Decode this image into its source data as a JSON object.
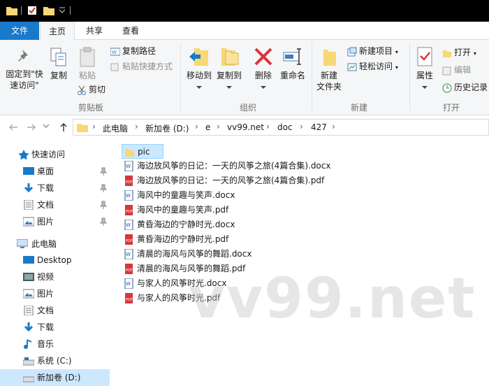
{
  "ribbon_tabs": [
    "文件",
    "主页",
    "共享",
    "查看"
  ],
  "clipboard": {
    "pin_label_1": "固定到\"快",
    "pin_label_2": "速访问\"",
    "copy": "复制",
    "paste": "粘贴",
    "copy_path": "复制路径",
    "paste_shortcut": "粘贴快捷方式",
    "cut": "剪切",
    "group": "剪贴板"
  },
  "organize": {
    "move_to": "移动到",
    "copy_to": "复制到",
    "delete": "删除",
    "rename": "重命名",
    "group": "组织"
  },
  "new": {
    "new_folder_1": "新建",
    "new_folder_2": "文件夹",
    "new_item": "新建项目",
    "easy_access": "轻松访问",
    "group": "新建"
  },
  "open": {
    "properties": "属性",
    "open": "打开",
    "edit": "编辑",
    "history": "历史记录",
    "group": "打开"
  },
  "address": {
    "crumbs": [
      "此电脑",
      "新加卷 (D:)",
      "e",
      "vv99.net",
      "doc",
      "427"
    ]
  },
  "nav": {
    "quick_access": "快速访问",
    "quick_items": [
      "桌面",
      "下载",
      "文档",
      "图片"
    ],
    "this_pc": "此电脑",
    "pc_items": [
      "Desktop",
      "视频",
      "图片",
      "文档",
      "下载",
      "音乐",
      "系统 (C:)",
      "新加卷 (D:)"
    ]
  },
  "files": [
    {
      "name": "pic",
      "type": "folder"
    },
    {
      "name": "海边放风筝的日记：一天的风筝之旅(4篇合集).docx",
      "type": "docx"
    },
    {
      "name": "海边放风筝的日记：一天的风筝之旅(4篇合集).pdf",
      "type": "pdf"
    },
    {
      "name": "海风中的童趣与笑声.docx",
      "type": "docx"
    },
    {
      "name": "海风中的童趣与笑声.pdf",
      "type": "pdf"
    },
    {
      "name": "黄昏海边的宁静时光.docx",
      "type": "docx"
    },
    {
      "name": "黄昏海边的宁静时光.pdf",
      "type": "pdf"
    },
    {
      "name": "清晨的海风与风筝的舞蹈.docx",
      "type": "docx"
    },
    {
      "name": "清晨的海风与风筝的舞蹈.pdf",
      "type": "pdf"
    },
    {
      "name": "与家人的风筝时光.docx",
      "type": "docx"
    },
    {
      "name": "与家人的风筝时光.pdf",
      "type": "pdf"
    }
  ],
  "watermark": "vv99.net",
  "colors": {
    "file_tab": "#1979ca",
    "selection": "#cce8ff",
    "folder": "#f8d775",
    "pdf": "#d9353a",
    "docx": "#2b5797"
  }
}
